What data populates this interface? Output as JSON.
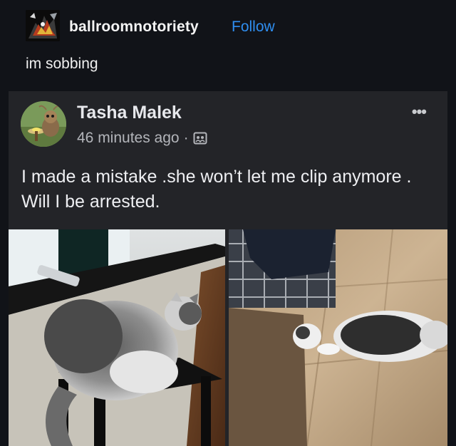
{
  "post": {
    "blog_name": "ballroomnotoriety",
    "follow_label": "Follow",
    "caption": "im sobbing"
  },
  "embedded_post": {
    "author": "Tasha Malek",
    "timestamp": "46 minutes ago",
    "separator": "·",
    "more_icon": "•••",
    "text": "I made a mistake .she won’t let me clip anymore . Will I be arrested."
  },
  "icons": {
    "blog_avatar": "blog-avatar-illustration",
    "audience": "group-audience-icon",
    "more": "more-options-icon"
  },
  "colors": {
    "background": "#111318",
    "card": "#232428",
    "follow": "#2f8ef0"
  }
}
